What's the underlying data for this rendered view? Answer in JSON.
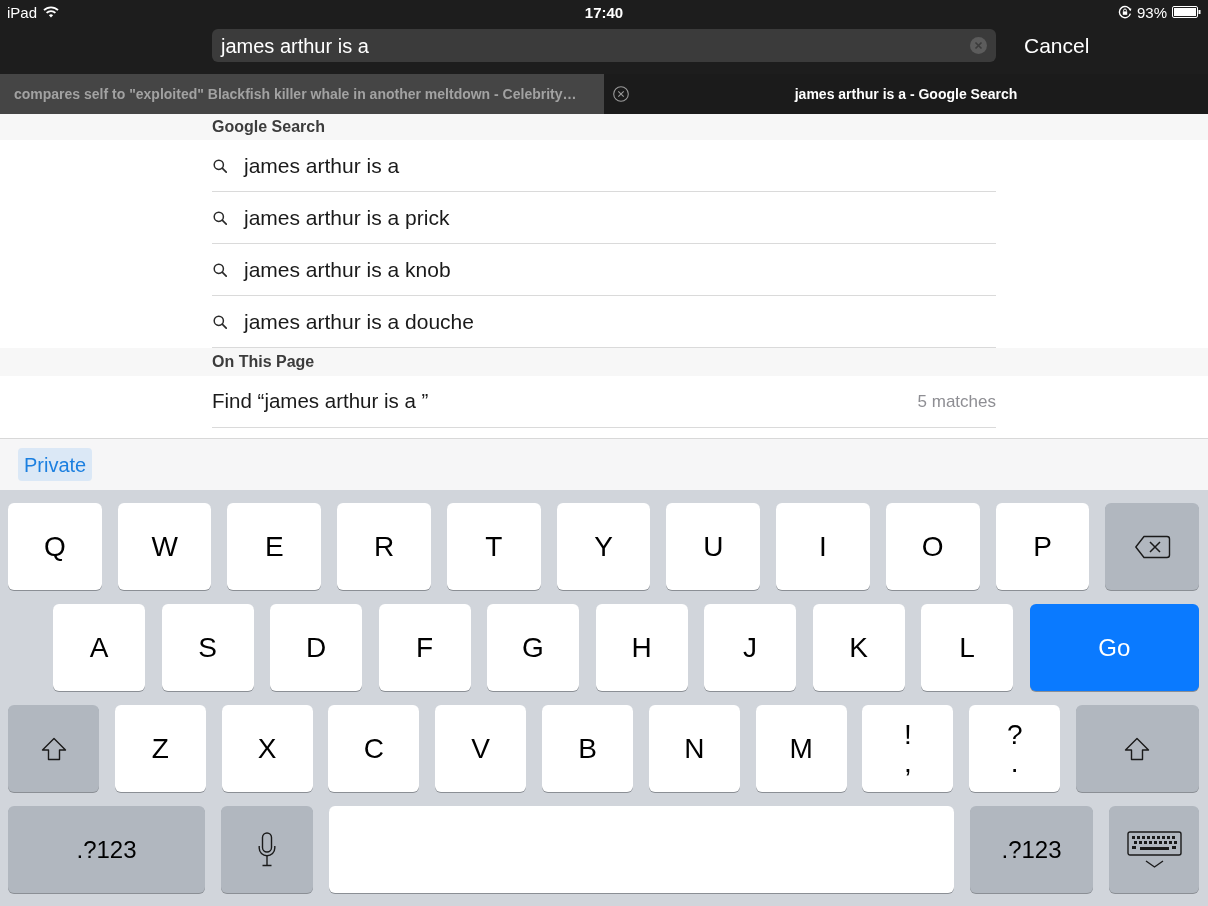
{
  "status_bar": {
    "carrier": "iPad",
    "time": "17:40",
    "battery": "93%"
  },
  "search_field": {
    "value": "james arthur is a"
  },
  "cancel_button": {
    "label": "Cancel"
  },
  "tabs": [
    {
      "title": "compares self to \"exploited\" Blackfish killer whale in another meltdown - Celebrity…",
      "selected": false
    },
    {
      "title": "james arthur is a - Google Search",
      "selected": true
    }
  ],
  "sections": [
    {
      "title": "Google Search",
      "rows": [
        {
          "kind": "suggestion",
          "text": "james arthur is a"
        },
        {
          "kind": "suggestion",
          "text": "james arthur is a prick"
        },
        {
          "kind": "suggestion",
          "text": "james arthur is a knob"
        },
        {
          "kind": "suggestion",
          "text": "james arthur is a douche"
        }
      ]
    },
    {
      "title": "On This Page",
      "rows": [
        {
          "kind": "find",
          "text": "Find “james arthur is a ”",
          "count": "5 matches"
        }
      ]
    }
  ],
  "accessory_bar": {
    "private_button": {
      "label": "Private",
      "on": true
    }
  },
  "keyboard": {
    "rows": [
      {
        "keys": [
          {
            "kind": "letter",
            "label": "Q"
          },
          {
            "kind": "letter",
            "label": "W"
          },
          {
            "kind": "letter",
            "label": "E"
          },
          {
            "kind": "letter",
            "label": "R"
          },
          {
            "kind": "letter",
            "label": "T"
          },
          {
            "kind": "letter",
            "label": "Y"
          },
          {
            "kind": "letter",
            "label": "U"
          },
          {
            "kind": "letter",
            "label": "I"
          },
          {
            "kind": "letter",
            "label": "O"
          },
          {
            "kind": "letter",
            "label": "P"
          },
          {
            "kind": "delete"
          }
        ]
      },
      {
        "keys": [
          {
            "kind": "letter",
            "label": "A"
          },
          {
            "kind": "letter",
            "label": "S"
          },
          {
            "kind": "letter",
            "label": "D"
          },
          {
            "kind": "letter",
            "label": "F"
          },
          {
            "kind": "letter",
            "label": "G"
          },
          {
            "kind": "letter",
            "label": "H"
          },
          {
            "kind": "letter",
            "label": "J"
          },
          {
            "kind": "letter",
            "label": "K"
          },
          {
            "kind": "letter",
            "label": "L"
          },
          {
            "kind": "go",
            "label": "Go"
          }
        ]
      },
      {
        "keys": [
          {
            "kind": "shift"
          },
          {
            "kind": "letter",
            "label": "Z"
          },
          {
            "kind": "letter",
            "label": "X"
          },
          {
            "kind": "letter",
            "label": "C"
          },
          {
            "kind": "letter",
            "label": "V"
          },
          {
            "kind": "letter",
            "label": "B"
          },
          {
            "kind": "letter",
            "label": "N"
          },
          {
            "kind": "letter",
            "label": "M"
          },
          {
            "kind": "punct",
            "labels": [
              "!",
              ","
            ]
          },
          {
            "kind": "punct",
            "labels": [
              "?",
              "."
            ]
          },
          {
            "kind": "shift"
          }
        ]
      },
      {
        "keys": [
          {
            "kind": "mode",
            "label": ".?123"
          },
          {
            "kind": "mic"
          },
          {
            "kind": "space"
          },
          {
            "kind": "mode",
            "label": ".?123"
          },
          {
            "kind": "hide"
          }
        ]
      }
    ]
  }
}
